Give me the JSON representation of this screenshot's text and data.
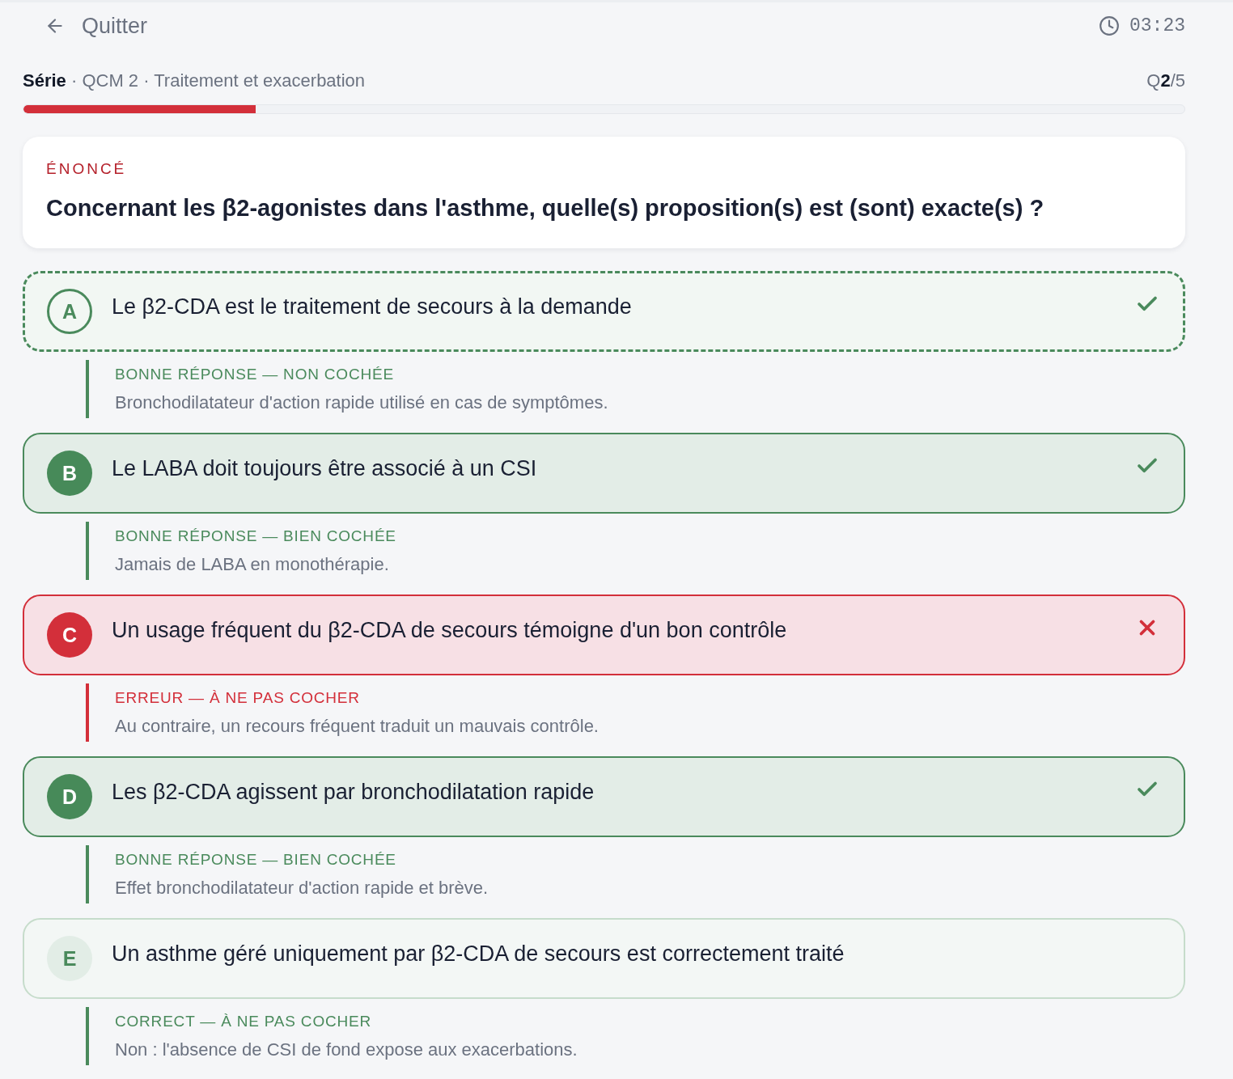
{
  "header": {
    "back_label": "Quitter",
    "timer": "03:23"
  },
  "breadcrumb": "**Série** · QCM 2 · Traitement et exacerbation",
  "counter": "Q**2**/5",
  "progress": {
    "level": 0.2
  },
  "question": {
    "label": "ÉNONCÉ",
    "text": "Concernant les β2-agonistes dans l'asthme, quelle(s) proposition(s) est (sont) exacte(s) ?"
  },
  "options": [
    {
      "letter": "A",
      "text": "Le β2-CDA est le traitement de secours à la demande",
      "checked": false,
      "correct": true,
      "verdict": "BONNE RÉPONSE — NON COCHÉE",
      "explanation": "Bronchodilatateur d'action rapide utilisé en cas de symptômes."
    },
    {
      "letter": "B",
      "text": "Le LABA doit toujours être associé à un CSI",
      "checked": true,
      "correct": true,
      "verdict": "BONNE RÉPONSE — BIEN COCHÉE",
      "explanation": "Jamais de LABA en monothérapie."
    },
    {
      "letter": "C",
      "text": "Un usage fréquent du β2-CDA de secours témoigne d'un bon contrôle",
      "checked": true,
      "correct": false,
      "verdict": "ERREUR — À NE PAS COCHER",
      "explanation": "Au contraire, un recours fréquent traduit un mauvais contrôle."
    },
    {
      "letter": "D",
      "text": "Les β2-CDA agissent par bronchodilatation rapide",
      "checked": true,
      "correct": true,
      "verdict": "BONNE RÉPONSE — BIEN COCHÉE",
      "explanation": "Effet bronchodilatateur d'action rapide et brève."
    },
    {
      "letter": "E",
      "text": "Un asthme géré uniquement par β2-CDA de secours est correctement traité",
      "checked": false,
      "correct": false,
      "verdict": "CORRECT — À NE PAS COCHER",
      "explanation": "Non : l'absence de CSI de fond expose aux exacerbations."
    }
  ]
}
